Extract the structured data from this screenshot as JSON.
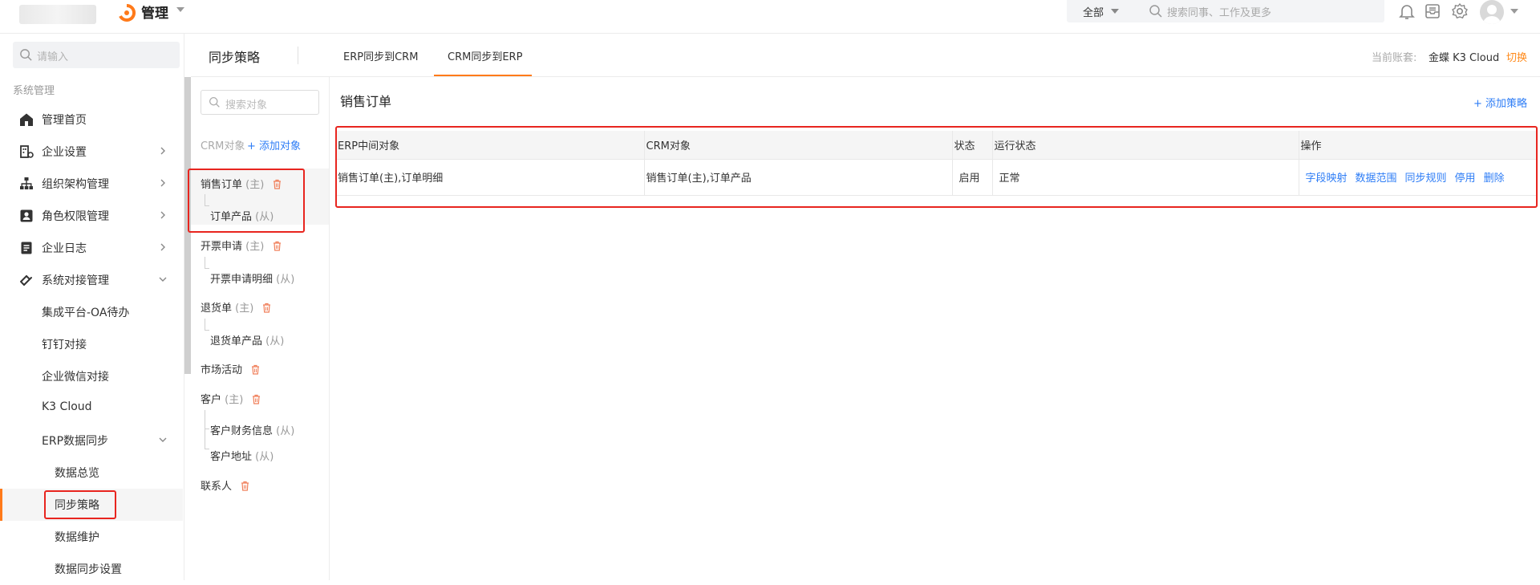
{
  "topbar": {
    "app_title": "管理",
    "search_scope": "全部",
    "search_placeholder": "搜索同事、工作及更多"
  },
  "sidebar": {
    "search_placeholder": "请输入",
    "section_label": "系统管理",
    "items": [
      {
        "label": "管理首页",
        "icon": "home-icon"
      },
      {
        "label": "企业设置",
        "icon": "enterprise-icon"
      },
      {
        "label": "组织架构管理",
        "icon": "org-chart-icon"
      },
      {
        "label": "角色权限管理",
        "icon": "role-icon"
      },
      {
        "label": "企业日志",
        "icon": "log-icon"
      },
      {
        "label": "系统对接管理",
        "icon": "integration-icon"
      }
    ],
    "sub_items": [
      "集成平台-OA待办",
      "钉钉对接",
      "企业微信对接",
      "K3 Cloud",
      "ERP数据同步"
    ],
    "sub_sub_items": [
      "数据总览",
      "同步策略",
      "数据维护",
      "数据同步设置"
    ]
  },
  "header": {
    "page_title": "同步策略",
    "tabs": [
      {
        "label": "ERP同步到CRM"
      },
      {
        "label": "CRM同步到ERP"
      }
    ],
    "account_label": "当前账套:",
    "account_name": "金蝶 K3 Cloud",
    "switch_label": "切换"
  },
  "objects": {
    "search_placeholder": "搜索对象",
    "heading": "CRM对象",
    "add_label": "添加对象",
    "master_suffix": "(主)",
    "detail_suffix": "(从)",
    "list": [
      {
        "name": "销售订单",
        "role": "(主)",
        "children": [
          "订单产品"
        ]
      },
      {
        "name": "开票申请",
        "role": "(主)",
        "children": [
          "开票申请明细"
        ]
      },
      {
        "name": "退货单",
        "role": "(主)",
        "children": [
          "退货单产品"
        ]
      },
      {
        "name": "市场活动",
        "role": "",
        "children": []
      },
      {
        "name": "客户",
        "role": "(主)",
        "children": [
          "客户财务信息",
          "客户地址"
        ]
      },
      {
        "name": "联系人",
        "role": "",
        "children": []
      }
    ]
  },
  "content": {
    "title": "销售订单",
    "add_strategy": "添加策略",
    "columns": [
      "ERP中间对象",
      "CRM对象",
      "状态",
      "运行状态",
      "操作"
    ],
    "rows": [
      {
        "erp_object": "销售订单(主),订单明细",
        "crm_object": "销售订单(主),订单产品",
        "status": "启用",
        "run_status": "正常",
        "actions": [
          "字段映射",
          "数据范围",
          "同步规则",
          "停用",
          "删除"
        ]
      }
    ]
  },
  "colors": {
    "accent": "#ff7a1a",
    "link": "#2e7df6",
    "highlight": "#e8251f"
  }
}
